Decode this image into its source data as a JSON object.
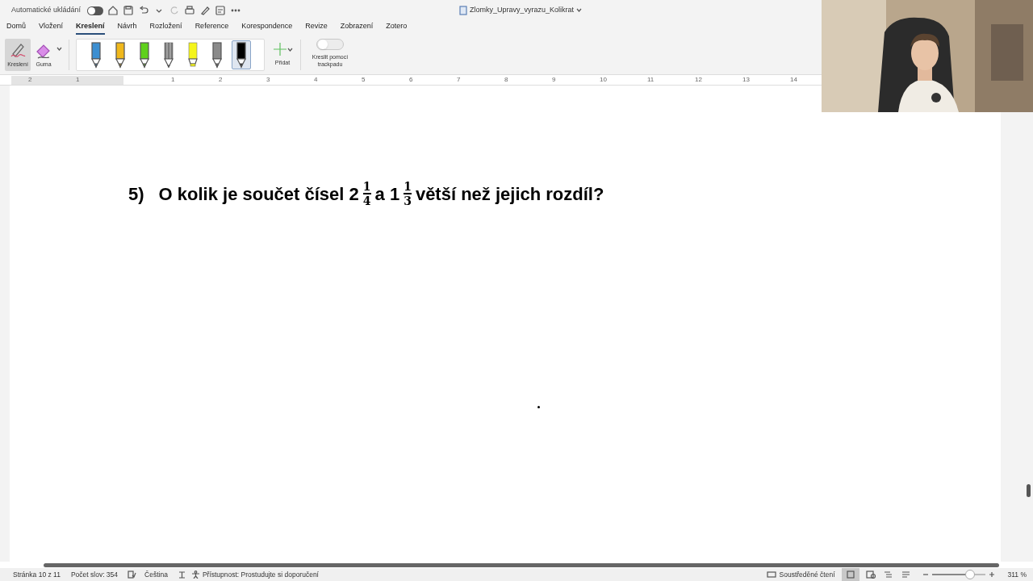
{
  "title_bar": {
    "autosave_label": "Automatické ukládání",
    "autosave_on": false,
    "document_title": "Zlomky_Upravy_vyrazu_Kolikrat"
  },
  "tabs": [
    {
      "label": "Domů",
      "selected": false
    },
    {
      "label": "Vložení",
      "selected": false
    },
    {
      "label": "Kreslení",
      "selected": true
    },
    {
      "label": "Návrh",
      "selected": false
    },
    {
      "label": "Rozložení",
      "selected": false
    },
    {
      "label": "Reference",
      "selected": false
    },
    {
      "label": "Korespondence",
      "selected": false
    },
    {
      "label": "Revize",
      "selected": false
    },
    {
      "label": "Zobrazení",
      "selected": false
    },
    {
      "label": "Zotero",
      "selected": false
    }
  ],
  "ribbon": {
    "tools": [
      {
        "kind": "draw",
        "label": "Kreslení",
        "selected": true
      },
      {
        "kind": "eraser",
        "label": "Guma",
        "selected": false
      }
    ],
    "pens": [
      {
        "kind": "pen",
        "color": "#3d8fd1",
        "selected": false
      },
      {
        "kind": "pen",
        "color": "#f0b81c",
        "selected": false
      },
      {
        "kind": "pen",
        "color": "#5fd11c",
        "selected": false
      },
      {
        "kind": "pencil",
        "color": "#7a7a7a",
        "selected": false
      },
      {
        "kind": "highlighter",
        "color": "#f5f51c",
        "selected": false
      },
      {
        "kind": "pen",
        "color": "#8a8a8a",
        "selected": false
      },
      {
        "kind": "pen",
        "color": "#000000",
        "selected": true
      }
    ],
    "add_label": "Přidat",
    "trackpad": {
      "label": "Kreslit pomocí trackpadu",
      "on": false
    }
  },
  "ruler": {
    "labels": [
      "2",
      "1",
      "1",
      "2",
      "3",
      "4",
      "5",
      "6",
      "7",
      "8",
      "9",
      "10",
      "11",
      "12",
      "13",
      "14"
    ]
  },
  "document": {
    "number": "5)",
    "parts": [
      {
        "kind": "text",
        "text": "O kolik je součet čísel 2"
      },
      {
        "kind": "fraction",
        "numerator": "1",
        "denominator": "4"
      },
      {
        "kind": "text",
        "text": "a 1"
      },
      {
        "kind": "fraction",
        "numerator": "1",
        "denominator": "3"
      },
      {
        "kind": "text",
        "text": "větší než jejich rozdíl?"
      }
    ]
  },
  "status_bar": {
    "page": "Stránka 10 z 11",
    "words": "Počet slov: 354",
    "language": "Čeština",
    "accessibility": "Přístupnost: Prostudujte si doporučení",
    "focus": "Soustředěné čtení",
    "zoom": {
      "level": 0.72,
      "reading": "311 %"
    }
  }
}
